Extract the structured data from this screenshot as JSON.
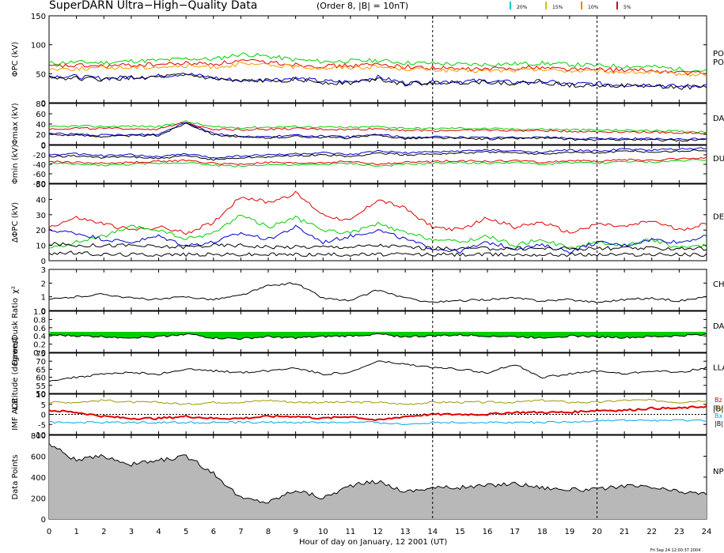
{
  "title": "SuperDARN Ultra−High−Quality Data",
  "subtitle": "(Order 8, |B| = 10nT)",
  "xlabel": "Hour of day on January, 12 2001 (UT)",
  "footer": "Fri Sep 24 12:00:37 2004",
  "legend_top": [
    {
      "label": "20%",
      "color": "#00c8c8"
    },
    {
      "label": "15%",
      "color": "#c8c800"
    },
    {
      "label": "10%",
      "color": "#e08a00"
    },
    {
      "label": "5%",
      "color": "#e00000"
    }
  ],
  "colors": {
    "red": "#e00000",
    "green": "#00d000",
    "blue": "#0000cc",
    "black": "#000000",
    "orange": "#ff9900",
    "grey": "#b8b8b8",
    "purple": "#7a007a",
    "cyan": "#00a8e0",
    "olive": "#9a9a00"
  },
  "chart_data": {
    "type": "line",
    "x_range": [
      0,
      24
    ],
    "x_ticks": [
      "0",
      "1",
      "2",
      "3",
      "4",
      "5",
      "6",
      "7",
      "8",
      "9",
      "10",
      "11",
      "12",
      "13",
      "14",
      "15",
      "16",
      "17",
      "18",
      "19",
      "20",
      "21",
      "22",
      "23",
      "24"
    ],
    "x_markers": [
      14,
      20
    ],
    "panels": [
      {
        "id": "phi-pc",
        "ylabel": "ΦPC (kV)",
        "ylim": [
          0,
          150
        ],
        "ticks": [
          "0",
          "50",
          "100",
          "150"
        ],
        "right_label": "PO\nPO",
        "series": [
          {
            "color": "green",
            "values": [
              68,
              70,
              69,
              72,
              73,
              76,
              75,
              84,
              80,
              74,
              71,
              72,
              73,
              69,
              68,
              66,
              66,
              67,
              68,
              66,
              64,
              63,
              62,
              58,
              55
            ]
          },
          {
            "color": "red",
            "values": [
              62,
              64,
              63,
              65,
              66,
              68,
              67,
              72,
              70,
              66,
              63,
              64,
              66,
              62,
              60,
              58,
              58,
              60,
              61,
              58,
              57,
              56,
              55,
              52,
              50
            ]
          },
          {
            "color": "orange",
            "values": [
              58,
              59,
              60,
              61,
              62,
              63,
              62,
              66,
              65,
              62,
              60,
              61,
              62,
              59,
              57,
              55,
              55,
              56,
              57,
              55,
              54,
              53,
              52,
              50,
              48
            ]
          },
          {
            "color": "blue",
            "values": [
              46,
              45,
              42,
              44,
              46,
              50,
              43,
              38,
              40,
              42,
              37,
              36,
              44,
              34,
              36,
              37,
              38,
              35,
              37,
              32,
              33,
              31,
              31,
              28,
              30
            ]
          },
          {
            "color": "black",
            "values": [
              44,
              42,
              40,
              43,
              44,
              48,
              41,
              36,
              38,
              40,
              35,
              34,
              42,
              32,
              34,
              35,
              36,
              33,
              35,
              30,
              31,
              29,
              29,
              26,
              28
            ]
          }
        ]
      },
      {
        "id": "phi-max",
        "ylabel": "Φmax (kV)",
        "ylim": [
          0,
          80
        ],
        "ticks": [
          "0",
          "20",
          "40",
          "60",
          "80"
        ],
        "right_label": "DAY",
        "series": [
          {
            "color": "green",
            "values": [
              34,
              36,
              35,
              36,
              35,
              45,
              34,
              33,
              34,
              35,
              34,
              33,
              35,
              32,
              31,
              32,
              31,
              30,
              30,
              29,
              28,
              28,
              27,
              26,
              25
            ]
          },
          {
            "color": "red",
            "values": [
              30,
              32,
              31,
              31,
              30,
              43,
              30,
              29,
              30,
              31,
              30,
              29,
              31,
              28,
              27,
              28,
              28,
              27,
              27,
              26,
              25,
              25,
              24,
              23,
              22
            ]
          },
          {
            "color": "blue",
            "values": [
              22,
              20,
              18,
              19,
              20,
              44,
              22,
              16,
              15,
              18,
              16,
              15,
              20,
              14,
              15,
              14,
              13,
              14,
              15,
              12,
              11,
              12,
              11,
              10,
              12
            ]
          },
          {
            "color": "black",
            "values": [
              20,
              18,
              16,
              17,
              18,
              42,
              20,
              14,
              13,
              16,
              14,
              13,
              18,
              12,
              13,
              12,
              11,
              12,
              13,
              10,
              9,
              10,
              9,
              8,
              10
            ]
          }
        ]
      },
      {
        "id": "phi-min",
        "ylabel": "Φmin (kV)",
        "ylim": [
          -80,
          0
        ],
        "ticks": [
          "-80",
          "-60",
          "-40",
          "-20",
          "0"
        ],
        "right_label": "DU",
        "series": [
          {
            "color": "green",
            "values": [
              -38,
              -40,
              -42,
              -40,
              -38,
              -36,
              -42,
              -44,
              -40,
              -42,
              -40,
              -38,
              -44,
              -40,
              -38,
              -36,
              -38,
              -36,
              -40,
              -36,
              -38,
              -34,
              -36,
              -32,
              -30
            ]
          },
          {
            "color": "red",
            "values": [
              -34,
              -36,
              -38,
              -36,
              -34,
              -32,
              -38,
              -40,
              -36,
              -38,
              -36,
              -34,
              -40,
              -36,
              -34,
              -32,
              -34,
              -32,
              -36,
              -32,
              -34,
              -30,
              -32,
              -28,
              -26
            ]
          },
          {
            "color": "blue",
            "values": [
              -20,
              -18,
              -22,
              -20,
              -24,
              -18,
              -26,
              -22,
              -20,
              -18,
              -16,
              -20,
              -12,
              -16,
              -14,
              -12,
              -10,
              -12,
              -14,
              -10,
              -12,
              -8,
              -10,
              -8,
              -6
            ]
          },
          {
            "color": "black",
            "values": [
              -24,
              -22,
              -26,
              -24,
              -28,
              -22,
              -30,
              -26,
              -24,
              -22,
              -20,
              -24,
              -16,
              -20,
              -18,
              -16,
              -14,
              -16,
              -18,
              -14,
              -16,
              -12,
              -14,
              -12,
              -10
            ]
          }
        ]
      },
      {
        "id": "delta-phi",
        "ylabel": "ΔΦPC (kV)",
        "ylim": [
          0,
          50
        ],
        "ticks": [
          "0",
          "10",
          "20",
          "30",
          "40",
          "50"
        ],
        "right_label": "DE",
        "series": [
          {
            "color": "red",
            "values": [
              22,
              28,
              24,
              20,
              22,
              18,
              25,
              42,
              38,
              44,
              30,
              26,
              40,
              34,
              22,
              20,
              28,
              22,
              25,
              18,
              24,
              22,
              26,
              20,
              24
            ]
          },
          {
            "color": "green",
            "values": [
              8,
              12,
              16,
              22,
              20,
              14,
              18,
              30,
              22,
              28,
              20,
              18,
              24,
              18,
              14,
              12,
              16,
              10,
              14,
              8,
              12,
              10,
              14,
              8,
              10
            ]
          },
          {
            "color": "blue",
            "values": [
              20,
              18,
              14,
              12,
              16,
              10,
              12,
              18,
              14,
              22,
              12,
              16,
              20,
              14,
              8,
              6,
              12,
              8,
              10,
              6,
              12,
              10,
              14,
              12,
              16
            ]
          },
          {
            "color": "black",
            "values": [
              11,
              10,
              10,
              10,
              9,
              9,
              10,
              10,
              9,
              9,
              9,
              9,
              10,
              9,
              8,
              8,
              8,
              8,
              8,
              8,
              8,
              8,
              8,
              8,
              8
            ]
          },
          {
            "color": "black",
            "values": [
              5,
              5,
              4,
              4,
              4,
              4,
              4,
              4,
              4,
              4,
              4,
              4,
              4,
              4,
              4,
              4,
              4,
              4,
              4,
              4,
              4,
              4,
              4,
              4,
              4
            ]
          }
        ]
      },
      {
        "id": "chi2",
        "ylabel": "χ²",
        "ylim": [
          0,
          3
        ],
        "ticks": [
          "0",
          "1",
          "2",
          "3"
        ],
        "right_label": "CH",
        "series": [
          {
            "color": "black",
            "values": [
              0.8,
              1.0,
              1.2,
              0.9,
              0.8,
              1.0,
              0.8,
              1.1,
              1.8,
              2.0,
              0.9,
              0.7,
              1.5,
              0.9,
              0.6,
              0.7,
              0.8,
              0.9,
              0.7,
              0.8,
              0.6,
              0.8,
              0.9,
              0.7,
              1.0
            ]
          }
        ]
      },
      {
        "id": "dawn-dusk",
        "ylabel": "Dawn/Dusk Ratio",
        "ylim": [
          0,
          1
        ],
        "ticks": [
          "0.0",
          "0.2",
          "0.4",
          "0.6",
          "0.8",
          "1.0"
        ],
        "right_label": "DAY",
        "series": [
          {
            "color": "black",
            "values": [
              0.42,
              0.4,
              0.38,
              0.36,
              0.38,
              0.45,
              0.35,
              0.33,
              0.38,
              0.35,
              0.38,
              0.4,
              0.44,
              0.38,
              0.4,
              0.42,
              0.4,
              0.38,
              0.36,
              0.4,
              0.38,
              0.36,
              0.38,
              0.4,
              0.44
            ]
          }
        ]
      },
      {
        "id": "latitude",
        "ylabel": "Latitude (degrees)",
        "ylim": [
          50,
          75
        ],
        "ticks": [
          "50",
          "55",
          "60",
          "65",
          "70",
          "75"
        ],
        "right_label": "LLA",
        "series": [
          {
            "color": "black",
            "values": [
              58,
              60,
              62,
              63,
              62,
              65,
              64,
              63,
              64,
              66,
              62,
              63,
              70,
              68,
              66,
              65,
              63,
              68,
              60,
              62,
              64,
              62,
              64,
              63,
              66
            ]
          }
        ]
      },
      {
        "id": "imf",
        "ylabel": "IMF ACE",
        "ylim": [
          -10,
          10
        ],
        "ticks": [
          "-10",
          "-5",
          "0",
          "5",
          "10"
        ],
        "right_label": "|B|",
        "labels_right": [
          "Bz",
          "By",
          "Bx",
          "|B|"
        ],
        "series": [
          {
            "color": "olive",
            "values": [
              6,
              6,
              7,
              6,
              6,
              5,
              6,
              6,
              7,
              6,
              6,
              6,
              6,
              5,
              6,
              6,
              6,
              6,
              7,
              6,
              6,
              7,
              7,
              6,
              7
            ]
          },
          {
            "color": "red",
            "values": [
              2,
              1,
              -1,
              -2,
              -2,
              -1,
              -2,
              -2,
              -1,
              -1,
              -2,
              -1,
              -3,
              -1,
              0,
              0,
              0,
              1,
              1,
              1,
              2,
              2,
              3,
              3,
              4
            ]
          },
          {
            "color": "cyan",
            "values": [
              -4,
              -4,
              -4,
              -4,
              -4,
              -4,
              -4,
              -4,
              -4,
              -4,
              -4,
              -4,
              -4,
              -5,
              -4,
              -4,
              -4,
              -4,
              -4,
              -4,
              -3,
              -3,
              -3,
              -3,
              -3
            ]
          }
        ]
      },
      {
        "id": "data-points",
        "ylabel": "Data Points",
        "ylim": [
          0,
          800
        ],
        "ticks": [
          "0",
          "200",
          "400",
          "600",
          "800"
        ],
        "right_label": "NP",
        "series": [
          {
            "color": "black",
            "fill": "grey",
            "values": [
              720,
              560,
              600,
              520,
              560,
              600,
              440,
              200,
              160,
              280,
              200,
              320,
              360,
              260,
              300,
              300,
              320,
              340,
              300,
              280,
              280,
              320,
              300,
              260,
              240
            ]
          }
        ]
      }
    ]
  }
}
